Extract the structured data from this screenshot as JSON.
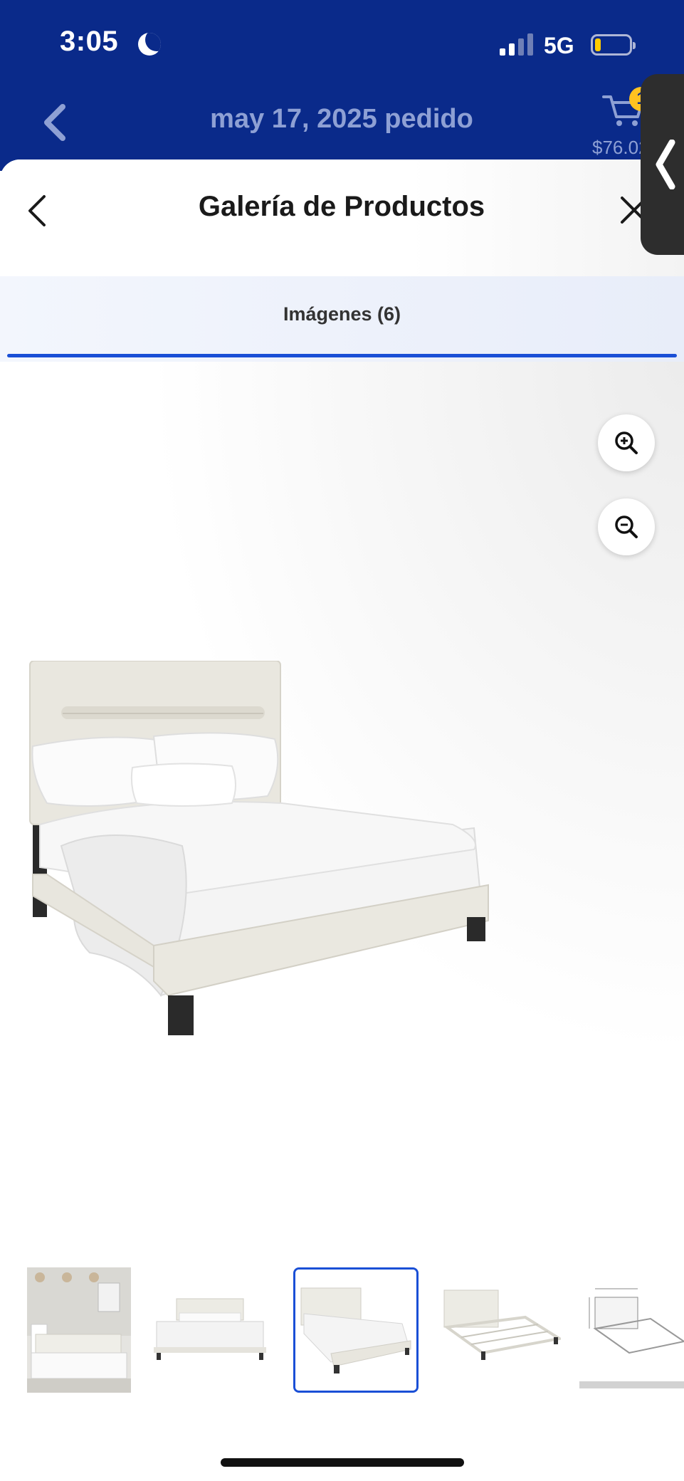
{
  "status_bar": {
    "time": "3:05",
    "network": "5G",
    "dnd_icon": "moon-icon",
    "signal_icon": "signal-bars-icon",
    "battery_icon": "battery-low-icon"
  },
  "app_header": {
    "title": "may 17, 2025 pedido",
    "cart_count": "1",
    "cart_total": "$76.02"
  },
  "sheet": {
    "title": "Galería de Productos",
    "back_icon": "chevron-left-icon",
    "close_icon": "close-icon"
  },
  "tabs": [
    {
      "label": "Imágenes (6)",
      "active": true
    }
  ],
  "viewer": {
    "zoom_in_icon": "zoom-in-icon",
    "zoom_out_icon": "zoom-out-icon"
  },
  "thumbnails": {
    "count_visible": 5,
    "selected_index": 2
  },
  "colors": {
    "header_blue": "#0a2a8a",
    "accent_blue": "#1a4fd6",
    "badge_yellow": "#ffc220"
  }
}
